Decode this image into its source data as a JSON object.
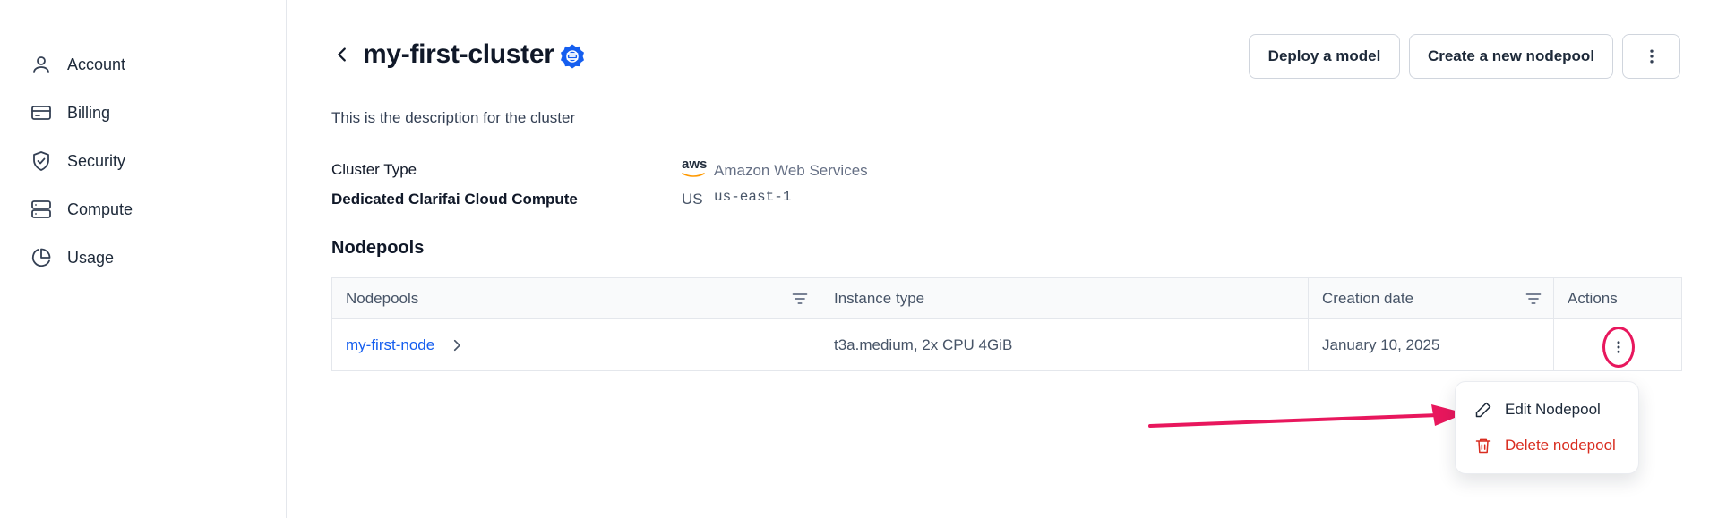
{
  "sidebar": {
    "items": [
      {
        "label": "Account",
        "icon": "user-icon"
      },
      {
        "label": "Billing",
        "icon": "credit-card-icon"
      },
      {
        "label": "Security",
        "icon": "shield-icon"
      },
      {
        "label": "Compute",
        "icon": "server-icon"
      },
      {
        "label": "Usage",
        "icon": "pie-chart-icon"
      }
    ]
  },
  "header": {
    "title": "my-first-cluster",
    "description": "This is the description for the cluster",
    "actions": {
      "deploy": "Deploy a model",
      "create": "Create a new nodepool"
    }
  },
  "properties": {
    "cluster_type_label": "Cluster Type",
    "cluster_type_logo": "aws",
    "cluster_type_value": "Amazon Web Services",
    "compute_label": "Dedicated Clarifai Cloud Compute",
    "region_flag": "US",
    "region_value": "us-east-1"
  },
  "nodepools": {
    "section_title": "Nodepools",
    "columns": [
      "Nodepools",
      "Instance type",
      "Creation date",
      "Actions"
    ],
    "rows": [
      {
        "name": "my-first-node",
        "instance": "t3a.medium, 2x CPU 4GiB",
        "created": "January 10, 2025"
      }
    ]
  },
  "row_menu": {
    "edit": "Edit Nodepool",
    "delete": "Delete nodepool"
  },
  "colors": {
    "accent": "#155eef",
    "danger": "#d92d20",
    "highlight": "#e8175d"
  }
}
